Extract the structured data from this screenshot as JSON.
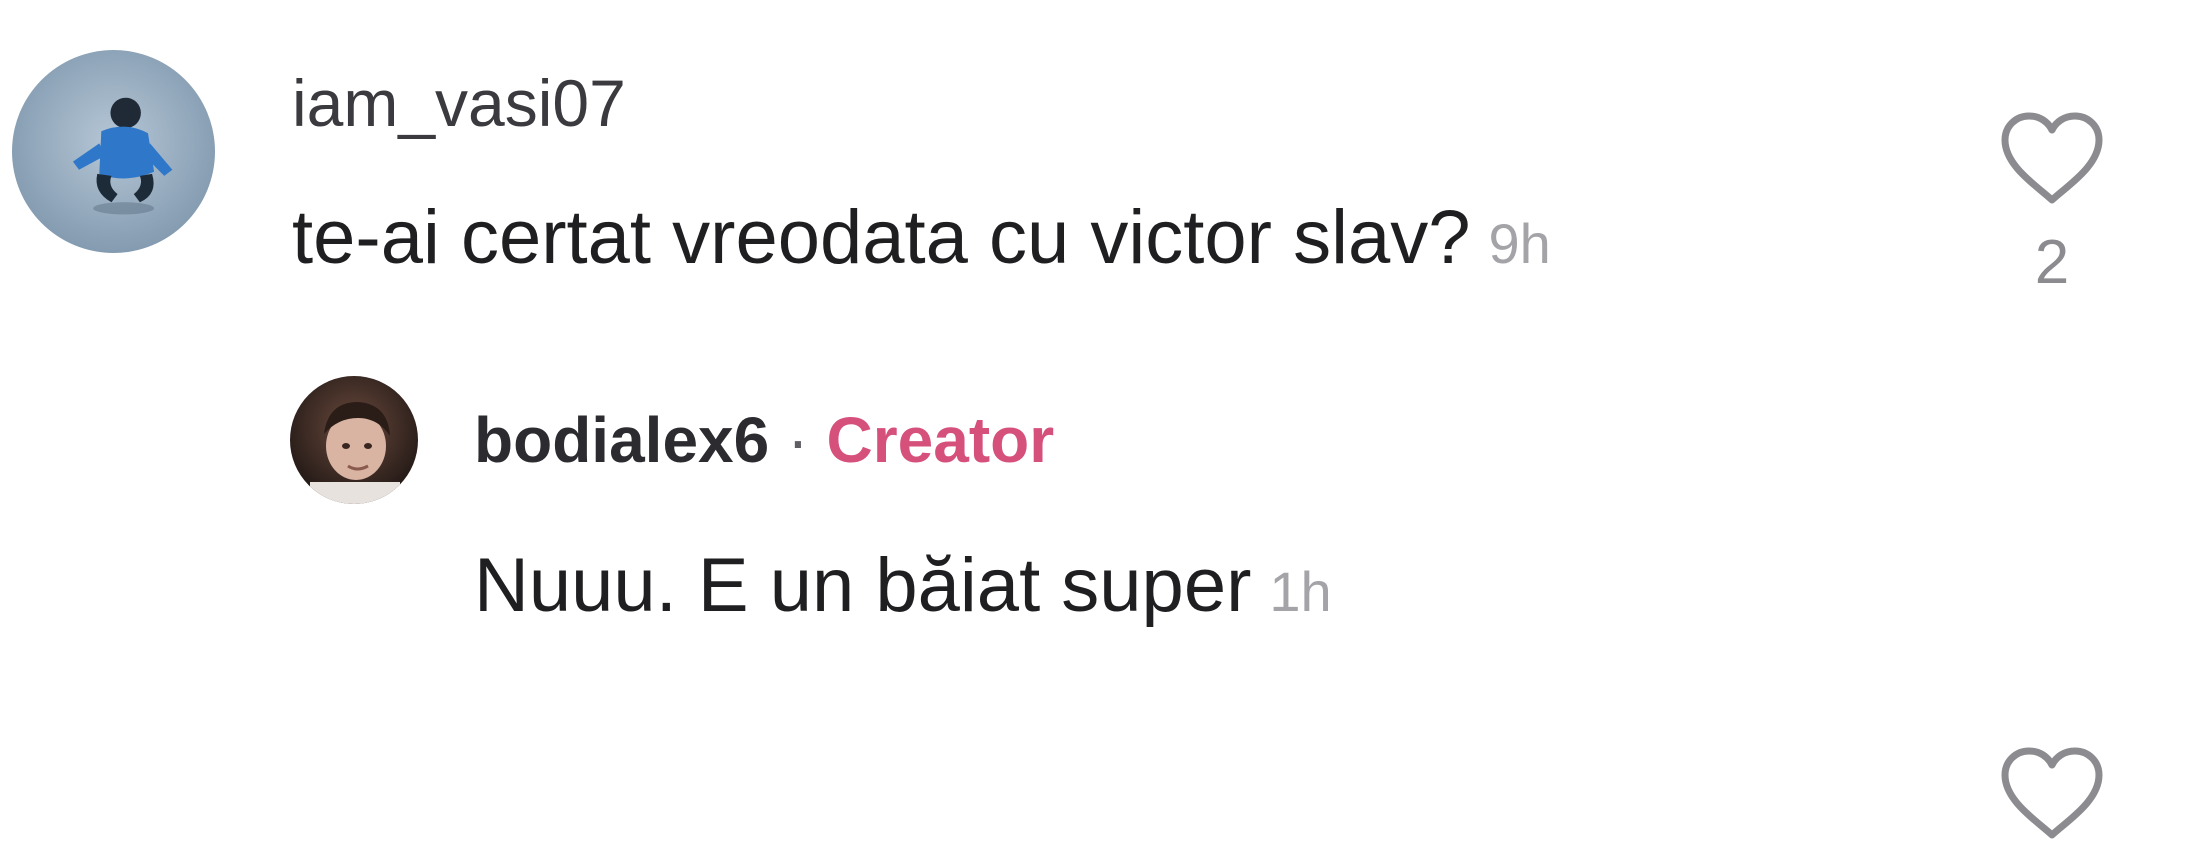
{
  "comment": {
    "username": "iam_vasi07",
    "text": "te-ai certat vreodata cu victor slav?",
    "time": "9h",
    "likes": "2",
    "avatar_icon": "user-avatar-icon",
    "like_icon": "heart-outline-icon"
  },
  "reply": {
    "username": "bodialex6",
    "separator": "·",
    "badge": "Creator",
    "text": "Nuuu. E un băiat super",
    "time": "1h",
    "avatar_icon": "user-avatar-icon",
    "like_icon": "heart-outline-icon"
  },
  "colors": {
    "creator_badge": "#d6507c",
    "timestamp": "#a4a4a8",
    "icon_gray": "#8c8c90"
  }
}
